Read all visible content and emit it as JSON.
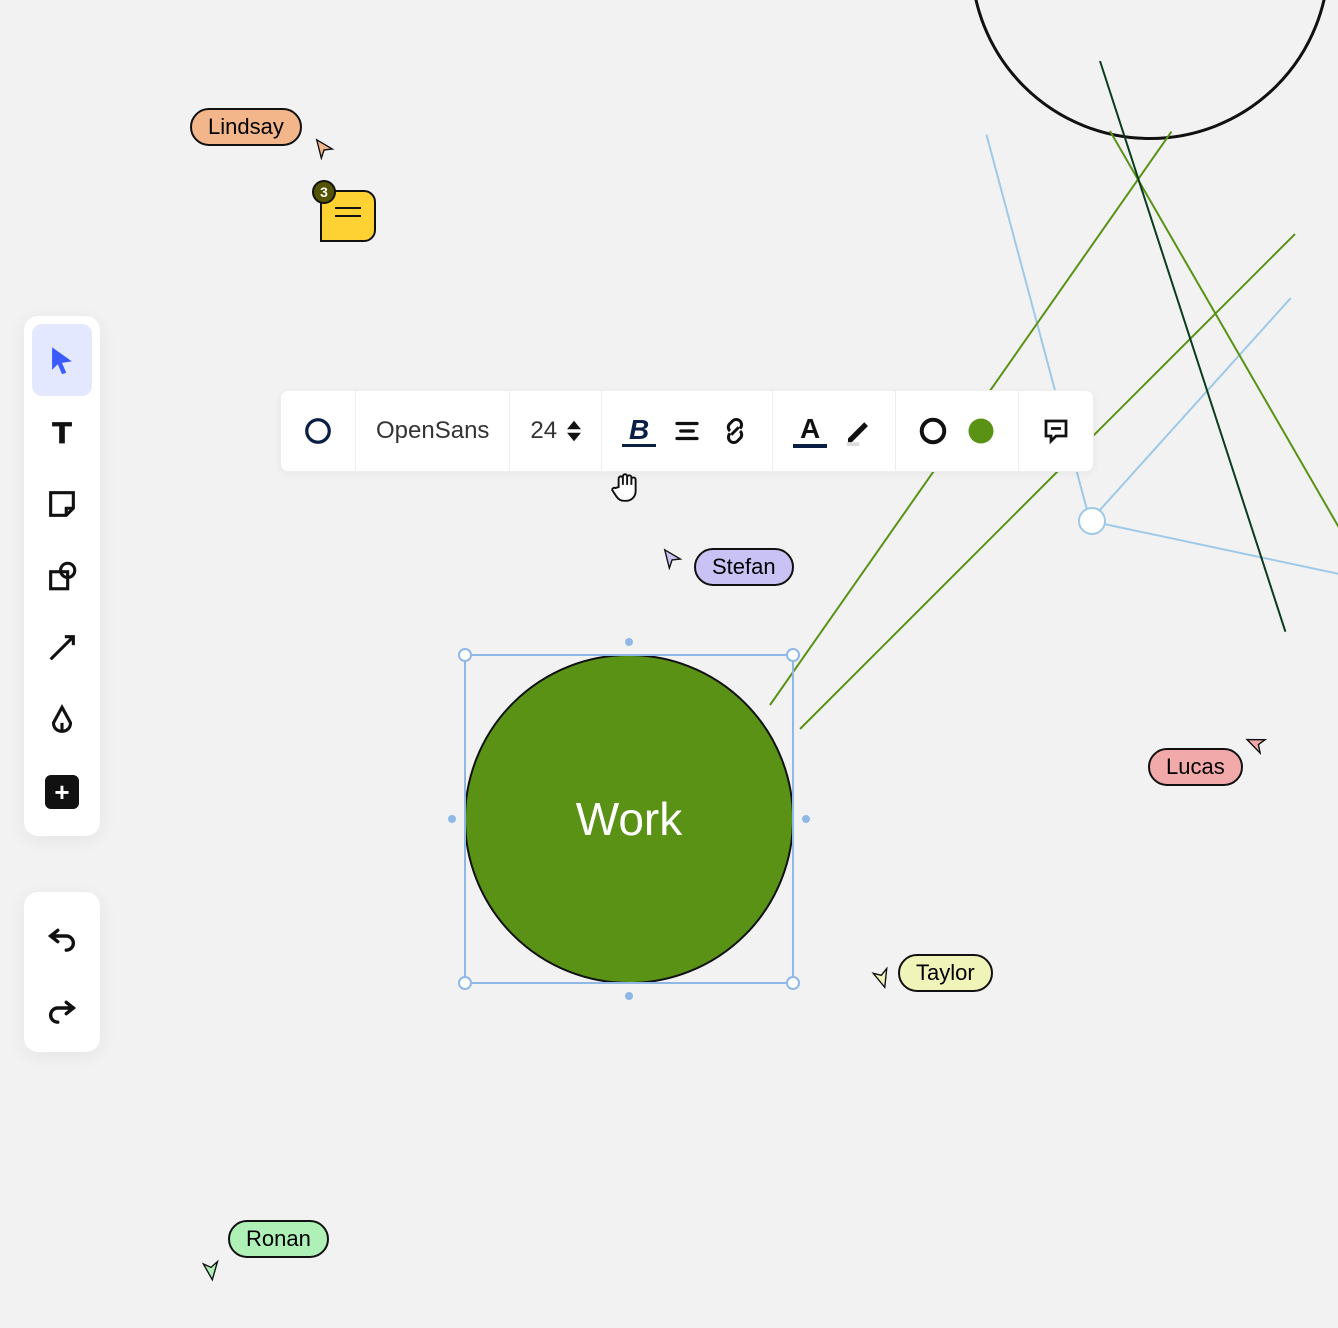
{
  "toolbar_left": {
    "tools": [
      "select",
      "text",
      "sticky",
      "shape",
      "arrow",
      "pen",
      "more"
    ],
    "active": "select"
  },
  "toolbar_undo": {
    "undo": "undo",
    "redo": "redo"
  },
  "context_toolbar": {
    "shape_icon": "circle-outline",
    "font_family": "OpenSans",
    "font_size": "24",
    "bold_icon": "B",
    "align_icon": "align-center",
    "link_icon": "link",
    "textcolor_icon": "A",
    "highlight_icon": "pencil",
    "stroke_swatch": "circle-outline",
    "fill_swatch_color": "#5a9216",
    "comment_icon": "comment"
  },
  "shape": {
    "label": "Work",
    "fill": "#5a9216"
  },
  "comment_pin": {
    "count": "3"
  },
  "collaborators": {
    "lindsay": {
      "name": "Lindsay",
      "color": "#f2b68a"
    },
    "stefan": {
      "name": "Stefan",
      "color": "#c9c2f4"
    },
    "lucas": {
      "name": "Lucas",
      "color": "#f2a9a9"
    },
    "taylor": {
      "name": "Taylor",
      "color": "#f0f4b8"
    },
    "ronan": {
      "name": "Ronan",
      "color": "#aef0b6"
    }
  }
}
